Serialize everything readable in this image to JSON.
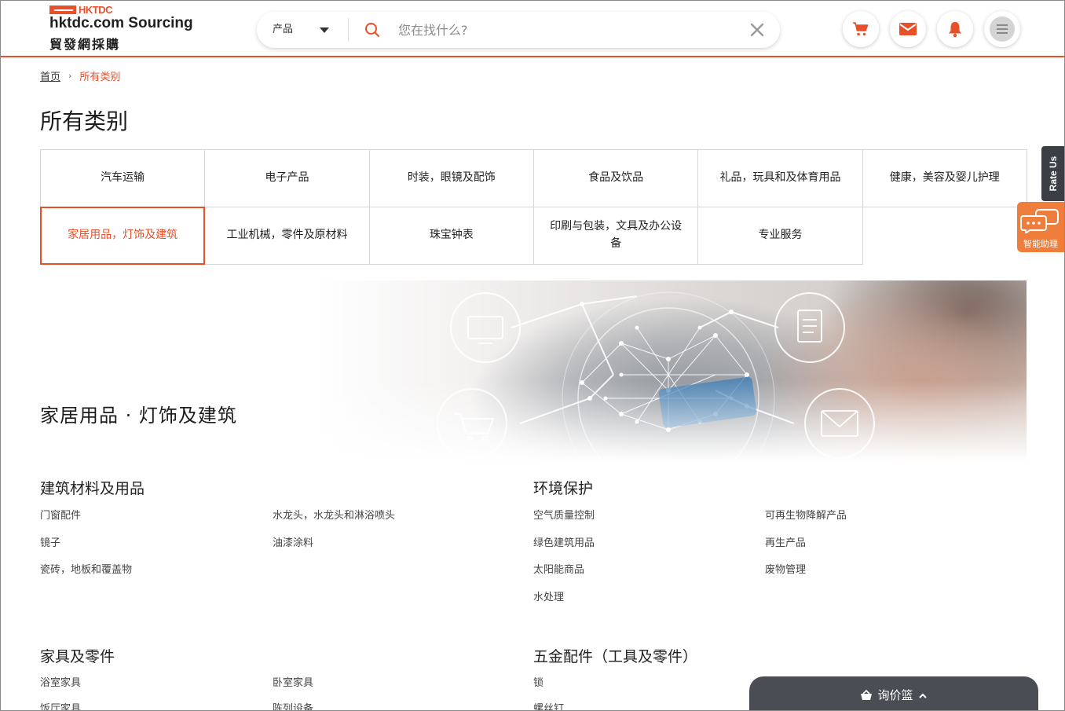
{
  "header": {
    "logo": {
      "mark": "HKTDC",
      "line1": "hktdc.com Sourcing",
      "line2": "貿發網採購"
    },
    "search": {
      "category": "产品",
      "placeholder": "您在找什么?"
    },
    "icons": [
      "cart-icon",
      "mail-icon",
      "bell-icon",
      "menu-icon"
    ],
    "accent": "#e8502a"
  },
  "breadcrumb": {
    "home": "首页",
    "current": "所有类别"
  },
  "page_title": "所有类别",
  "categories": [
    "汽车运输",
    "电子产品",
    "时装，眼镜及配饰",
    "食品及饮品",
    "礼品，玩具和及体育用品",
    "健康，美容及婴儿护理",
    "家居用品，灯饰及建筑",
    "工业机械，零件及原材料",
    "珠宝钟表",
    "印刷与包装，文具及办公设备",
    "专业服务"
  ],
  "active_category": "家居用品，灯饰及建筑",
  "banner": {
    "title": "家居用品 · 灯饰及建筑"
  },
  "sections": [
    {
      "title": "建筑材料及用品",
      "items": [
        "门窗配件",
        "水龙头，水龙头和淋浴喷头",
        "镜子",
        "油漆涂料",
        "瓷砖，地板和覆盖物"
      ]
    },
    {
      "title": "环境保护",
      "items": [
        "空气质量控制",
        "可再生物降解产品",
        "绿色建筑用品",
        "再生产品",
        "太阳能商品",
        "废物管理",
        "水处理"
      ]
    },
    {
      "title": "家具及零件",
      "items": [
        "浴室家具",
        "卧室家具",
        "饭厅家具",
        "陈列设备"
      ]
    },
    {
      "title": "五金配件（工具及零件）",
      "items": [
        "锁",
        "螺丝钉"
      ]
    }
  ],
  "side": {
    "rate_us": "Rate Us",
    "assistant": "智能助理"
  },
  "inquiry_basket": {
    "label": "询价篮"
  }
}
